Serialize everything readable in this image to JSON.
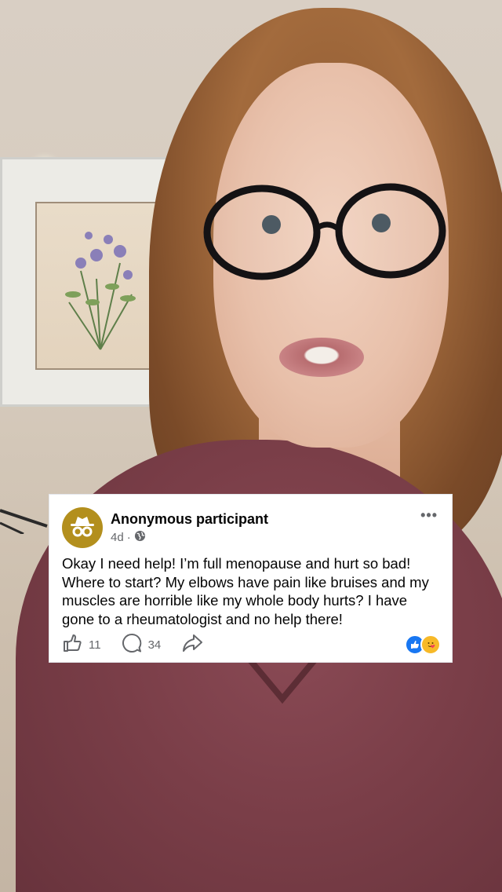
{
  "post": {
    "author": "Anonymous participant",
    "age": "4d",
    "separator": "·",
    "privacy_icon": "globe-icon",
    "avatar_icon": "incognito-icon",
    "menu": "•••",
    "text": "Okay I need help! I’m full menopause and hurt so bad! Where to start? My elbows have pain like bruises and my muscles are horrible like my whole body hurts? I have gone to a rheumatologist and no help there!",
    "likes": "11",
    "comments": "34",
    "reactions": [
      "like-reaction-icon",
      "care-reaction-icon"
    ]
  },
  "colors": {
    "avatar_bg": "#b38f1d",
    "like_blue": "#1877f2",
    "care_yellow": "#f7b928"
  }
}
